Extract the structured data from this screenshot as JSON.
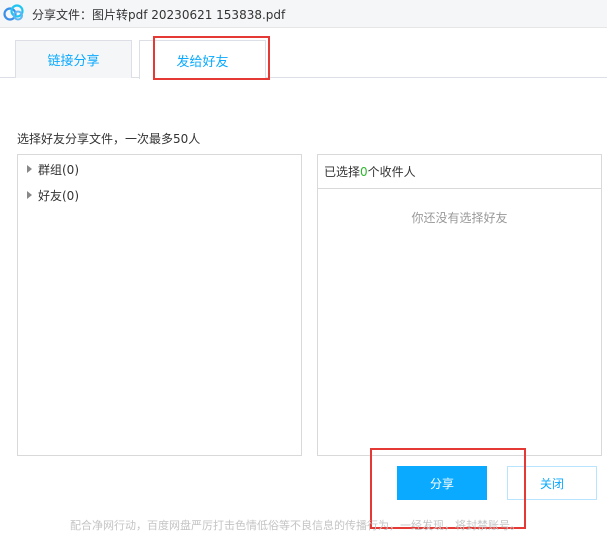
{
  "window": {
    "title": "分享文件：图片转pdf 20230621 153838.pdf",
    "logo_icon": "baidu-netdisk-logo"
  },
  "tabs": [
    {
      "label": "链接分享",
      "active": false
    },
    {
      "label": "发给好友",
      "active": true
    }
  ],
  "hint": "选择好友分享文件，一次最多50人",
  "friend_tree": [
    {
      "label": "群组(0)",
      "icon": "caret-right-icon"
    },
    {
      "label": "好友(0)",
      "icon": "caret-right-icon"
    }
  ],
  "selected_panel": {
    "prefix": "已选择",
    "count": "0",
    "suffix": "个收件人",
    "empty_text": "你还没有选择好友"
  },
  "buttons": {
    "share_label": "分享",
    "close_label": "关闭"
  },
  "footer": "配合净网行动，百度网盘严厉打击色情低俗等不良信息的传播行为，一经发现，将封禁账号。",
  "colors": {
    "accent": "#09aaff",
    "highlight_box": "#e53935",
    "count_green": "#2eb82e"
  }
}
